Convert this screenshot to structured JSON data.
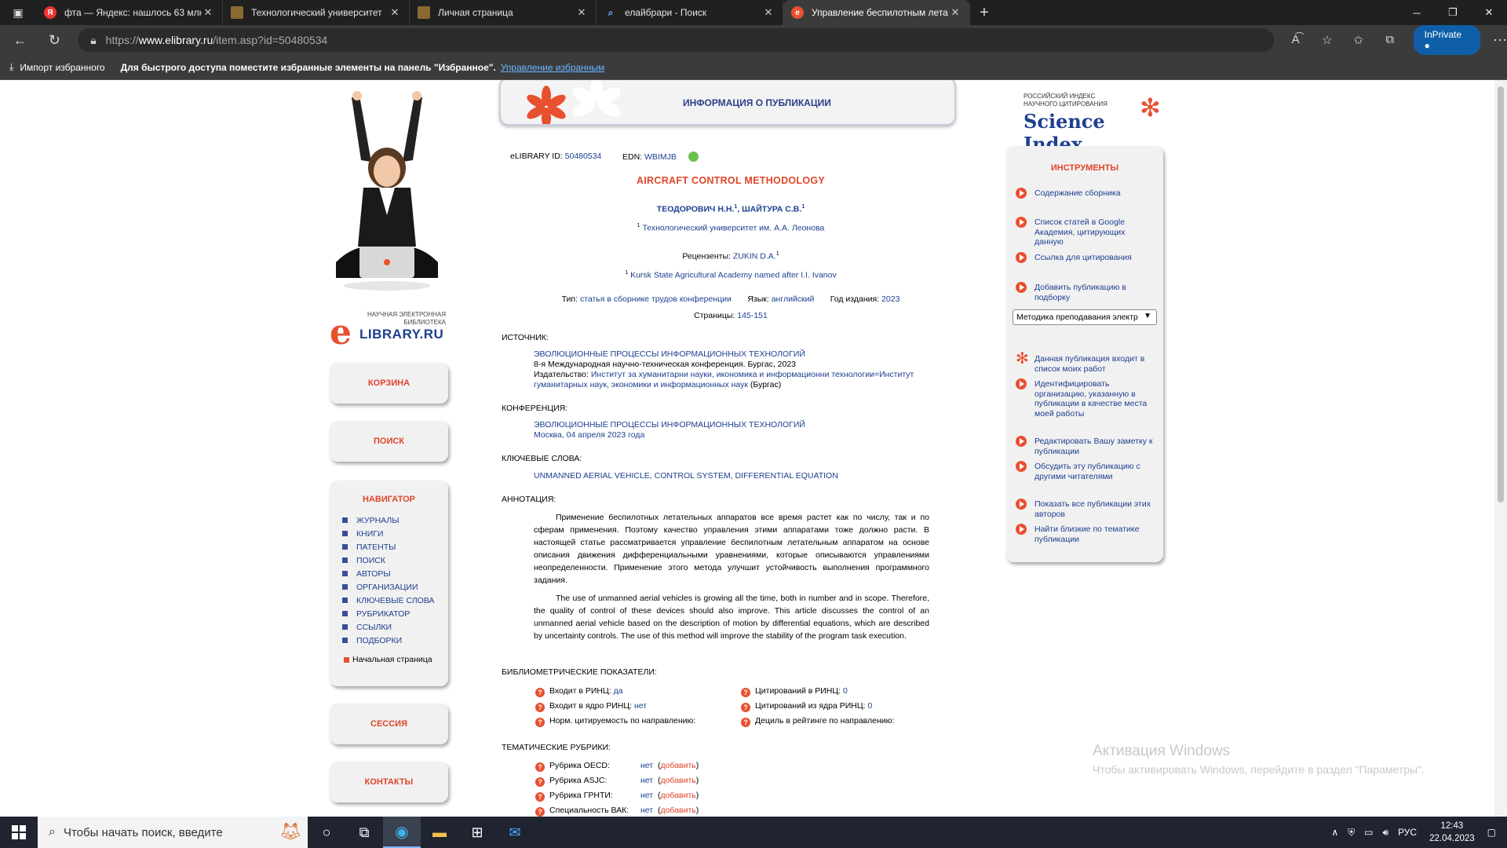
{
  "browser": {
    "tabs": [
      {
        "title": "фта — Яндекс: нашлось 63 млн",
        "fav_color": "#e33",
        "fav_char": "Я"
      },
      {
        "title": "Технологический университет",
        "fav_color": "#7a5a2a",
        "fav_char": ""
      },
      {
        "title": "Личная страница",
        "fav_color": "#7a5a2a",
        "fav_char": ""
      },
      {
        "title": "елайбрари - Поиск",
        "fav_color": "#3b3b3b",
        "fav_char": ""
      },
      {
        "title": "Управление беспилотным лета",
        "fav_color": "#e8502f",
        "fav_char": "e"
      }
    ],
    "url_prefix": "https://",
    "url_host": "www.elibrary.ru",
    "url_path": "/item.asp?id=50480534",
    "inprivate_label": "InPrivate",
    "favbar": {
      "import_label": "Импорт избранного",
      "hint": "Для быстрого доступа поместите избранные элементы на панель \"Избранное\".",
      "manage_link": "Управление избранным"
    }
  },
  "left": {
    "logo_small": "НАУЧНАЯ ЭЛЕКТРОННАЯ БИБЛИОТЕКА",
    "logo_main": "LIBRARY.RU",
    "cart": "КОРЗИНА",
    "search": "ПОИСК",
    "navigator_title": "НАВИГАТОР",
    "nav_items": [
      "ЖУРНАЛЫ",
      "КНИГИ",
      "ПАТЕНТЫ",
      "ПОИСК",
      "АВТОРЫ",
      "ОРГАНИЗАЦИИ",
      "КЛЮЧЕВЫЕ СЛОВА",
      "РУБРИКАТОР",
      "ССЫЛКИ",
      "ПОДБОРКИ"
    ],
    "home": "Начальная страница",
    "session": "СЕССИЯ",
    "contacts": "КОНТАКТЫ"
  },
  "banner_title": "ИНФОРМАЦИЯ О ПУБЛИКАЦИИ",
  "publication": {
    "elibrary_id_label": "eLIBRARY ID:",
    "elibrary_id": "50480534",
    "edn_label": "EDN:",
    "edn": "WBIMJB",
    "title": "AIRCRAFT CONTROL METHODOLOGY",
    "author1": "ТЕОДОРОВИЧ Н.Н.",
    "author2": "ШАЙТУРА С.В.",
    "affiliation": "Технологический университет им. А.А. Леонова",
    "reviewers_label": "Рецензенты:",
    "reviewer": "ZUKIN D.A.",
    "reviewer_affiliation": "Kursk State Agricultural Academy named after I.I. Ivanov",
    "type_label": "Тип:",
    "type": "статья в сборнике трудов конференции",
    "lang_label": "Язык:",
    "lang": "английский",
    "year_label": "Год издания:",
    "year": "2023",
    "pages_label": "Страницы:",
    "pages": "145-151",
    "source_label": "ИСТОЧНИК:",
    "source_title": "ЭВОЛЮЦИОННЫЕ ПРОЦЕССЫ ИНФОРМАЦИОННЫХ ТЕХНОЛОГИЙ",
    "source_line2": "8-я Международная научно-техническая конференция. Бургас, 2023",
    "publisher_label": "Издательство:",
    "publisher_line1": "Институт за хуманитарни науки, икономика и информационни технологии=Институт",
    "publisher_line2": "гуманитарных наук, экономики и информационных наук",
    "publisher_city": "(Бургас)",
    "conference_label": "КОНФЕРЕНЦИЯ:",
    "conference_title": "ЭВОЛЮЦИОННЫЕ ПРОЦЕССЫ ИНФОРМАЦИОННЫХ ТЕХНОЛОГИЙ",
    "conference_place": "Москва, 04 апреля 2023 года",
    "keywords_label": "КЛЮЧЕВЫЕ СЛОВА:",
    "keywords": "UNMANNED AERIAL VEHICLE, CONTROL SYSTEM, DIFFERENTIAL EQUATION",
    "annotation_label": "АННОТАЦИЯ:",
    "annotation_ru": "Применение беспилотных летательных аппаратов все время растет как по числу, так и по сферам применения. Поэтому качество управления этими аппаратами тоже должно расти. В настоящей статье рассматривается управление беспилотным летательным аппаратом на основе описания движения дифференциальными уравнениями, которые описываются управлениями неопределенности. Применение этого метода улучшит устойчивость выполнения программного задания.",
    "annotation_en": "The use of unmanned aerial vehicles is growing all the time, both in number and in scope. Therefore, the quality of control of these devices should also improve. This article discusses the control of an unmanned aerial vehicle based on the description of motion by differential equations, which are described by uncertainty controls. The use of this method will improve the stability of the program task execution.",
    "biblio_label": "БИБЛИОМЕТРИЧЕСКИЕ ПОКАЗАТЕЛИ:",
    "m1_label": "Входит в РИНЦ:",
    "m1_val": "да",
    "m2_label": "Входит в ядро РИНЦ:",
    "m2_val": "нет",
    "m3_label": "Норм. цитируемость по направлению:",
    "m4_label": "Цитирований в РИНЦ:",
    "m4_val": "0",
    "m5_label": "Цитирований из ядра РИНЦ:",
    "m5_val": "0",
    "m6_label": "Дециль в рейтинге по направлению:",
    "rubrics_label": "ТЕМАТИЧЕСКИЕ РУБРИКИ:",
    "rubrics": [
      {
        "label": "Рубрика OECD:",
        "val": "нет",
        "add": "добавить"
      },
      {
        "label": "Рубрика ASJC:",
        "val": "нет",
        "add": "добавить"
      },
      {
        "label": "Рубрика ГРНТИ:",
        "val": "нет",
        "add": "добавить"
      },
      {
        "label": "Специальность ВАК:",
        "val": "нет",
        "add": "добавить"
      }
    ]
  },
  "right": {
    "sci_small1": "РОССИЙСКИЙ ИНДЕКС",
    "sci_small2": "НАУЧНОГО ЦИТИРОВАНИЯ",
    "sci_main": "Science Index",
    "tools_title": "ИНСТРУМЕНТЫ",
    "tools": [
      "Содержание сборника",
      "Список статей в Google Академия, цитирующих данную",
      "Ссылка для цитирования",
      "Добавить публикацию в подборку",
      "Данная публикация входит в список моих работ",
      "Идентифицировать организацию, указанную в публикации в качестве места моей работы",
      "Редактировать Вашу заметку к публикации",
      "Обсудить эту публикацию с другими читателями",
      "Показать все публикации этих авторов",
      "Найти близкие по тематике публикации"
    ],
    "select_value": "Методика преподавания электр"
  },
  "watermark": {
    "line1": "Активация Windows",
    "line2": "Чтобы активировать Windows, перейдите в раздел \"Параметры\"."
  },
  "taskbar": {
    "search_placeholder": "Чтобы начать поиск, введите",
    "lang": "РУС",
    "time": "12:43",
    "date": "22.04.2023"
  }
}
